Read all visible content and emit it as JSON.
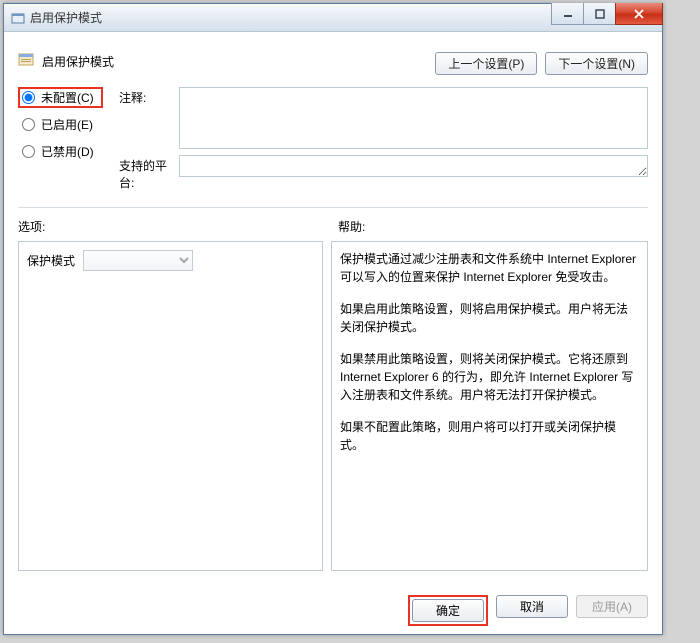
{
  "window": {
    "title": "启用保护模式"
  },
  "header": {
    "title": "启用保护模式",
    "prev_setting": "上一个设置(P)",
    "next_setting": "下一个设置(N)"
  },
  "radios": {
    "not_configured": "未配置(C)",
    "enabled": "已启用(E)",
    "disabled": "已禁用(D)"
  },
  "fields": {
    "comment_label": "注释:",
    "comment_value": "",
    "platform_label": "支持的平台:",
    "platform_value": ""
  },
  "mid": {
    "options_label": "选项:",
    "help_label": "帮助:"
  },
  "options": {
    "mode_label": "保护模式",
    "mode_value": ""
  },
  "help": {
    "p1": "保护模式通过减少注册表和文件系统中 Internet Explorer 可以写入的位置来保护 Internet Explorer 免受攻击。",
    "p2": "如果启用此策略设置，则将启用保护模式。用户将无法关闭保护模式。",
    "p3": "如果禁用此策略设置，则将关闭保护模式。它将还原到 Internet Explorer 6 的行为，即允许 Internet Explorer 写入注册表和文件系统。用户将无法打开保护模式。",
    "p4": "如果不配置此策略，则用户将可以打开或关闭保护模式。"
  },
  "footer": {
    "ok": "确定",
    "cancel": "取消",
    "apply": "应用(A)"
  }
}
